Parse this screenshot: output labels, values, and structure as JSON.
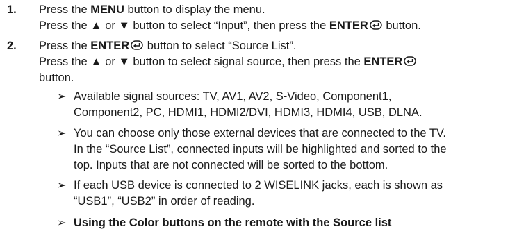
{
  "steps": [
    {
      "number": "1.",
      "lines": [
        {
          "pre": "Press the ",
          "kw": "MENU",
          "post": " button to display the menu."
        },
        {
          "pre": "Press the ▲ or ▼ button to select “Input”, then press the ",
          "kw": "ENTER",
          "post": " button."
        }
      ]
    },
    {
      "number": "2.",
      "lines": [
        {
          "pre": "Press the ",
          "kw": "ENTER",
          "post": " button to select “Source List”."
        },
        {
          "pre": "Press the ▲ or ▼ button to select signal source, then press the ",
          "kw": "ENTER",
          "post": ""
        },
        {
          "pre": "button.",
          "kw": "",
          "post": ""
        }
      ]
    }
  ],
  "enter_icon": "enter-return-icon",
  "note_marker": "➢",
  "notes": [
    {
      "bold": false,
      "lines": [
        "Available signal sources: TV, AV1, AV2, S-Video, Component1,",
        "Component2, PC, HDMI1, HDMI2/DVI, HDMI3, HDMI4, USB, DLNA."
      ]
    },
    {
      "bold": false,
      "lines": [
        "You can choose only those external devices that are connected to the TV.",
        "In the “Source List”, connected inputs will be highlighted and sorted to the",
        "top. Inputs that are not connected will be sorted to the bottom."
      ]
    },
    {
      "bold": false,
      "lines": [
        "If each USB device is connected to 2 WISELINK jacks, each is shown as",
        "“USB1”, “USB2” in order of reading."
      ]
    },
    {
      "bold": true,
      "lines": [
        "Using the Color buttons on the remote with the Source list"
      ]
    }
  ]
}
